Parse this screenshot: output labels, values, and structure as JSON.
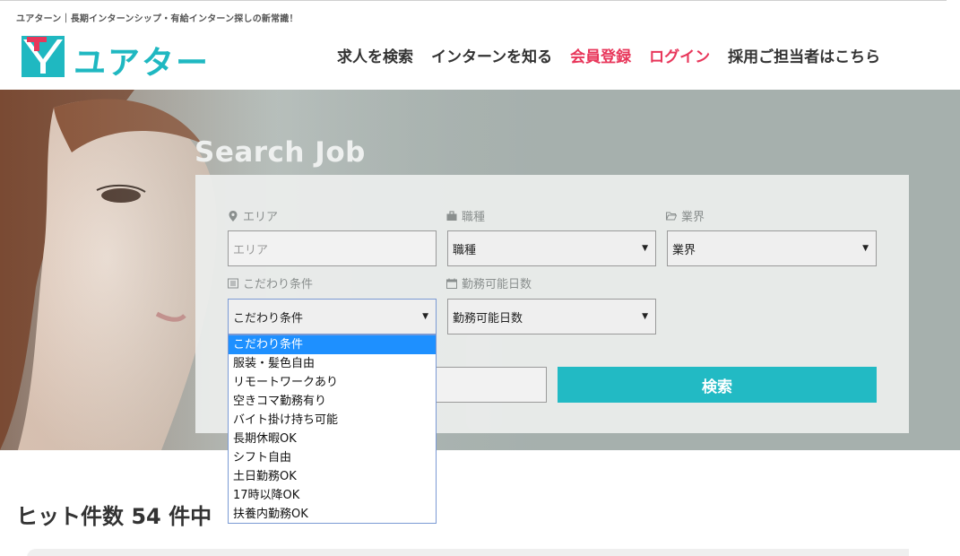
{
  "header": {
    "tagline": "ユアターン｜長期インターンシップ・有給インターン探しの新常識！",
    "logo_text": "ユアターン",
    "logo_mark_letters": "TY"
  },
  "nav": {
    "items": [
      {
        "label": "求人を検索",
        "accent": false
      },
      {
        "label": "インターンを知る",
        "accent": false
      },
      {
        "label": "会員登録",
        "accent": true
      },
      {
        "label": "ログイン",
        "accent": true
      },
      {
        "label": "採用ご担当者はこちら",
        "accent": false
      }
    ]
  },
  "search": {
    "heading": "Search Job",
    "area_label": "エリア",
    "area_placeholder": "エリア",
    "job_label": "職種",
    "job_value": "職種",
    "industry_label": "業界",
    "industry_value": "業界",
    "condition_label": "こだわり条件",
    "condition_value": "こだわり条件",
    "days_label": "勤務可能日数",
    "days_value": "勤務可能日数",
    "submit_label": "検索"
  },
  "condition_options": [
    "こだわり条件",
    "服装・髪色自由",
    "リモートワークあり",
    "空きコマ勤務有り",
    "バイト掛け持ち可能",
    "長期休暇OK",
    "シフト自由",
    "土日勤務OK",
    "17時以降OK",
    "扶養内勤務OK"
  ],
  "results": {
    "hits_text": "ヒット件数 54 件中"
  },
  "colors": {
    "brand_teal": "#22bac4",
    "accent_pink": "#e8365a",
    "selected_option": "#1e90ff"
  }
}
